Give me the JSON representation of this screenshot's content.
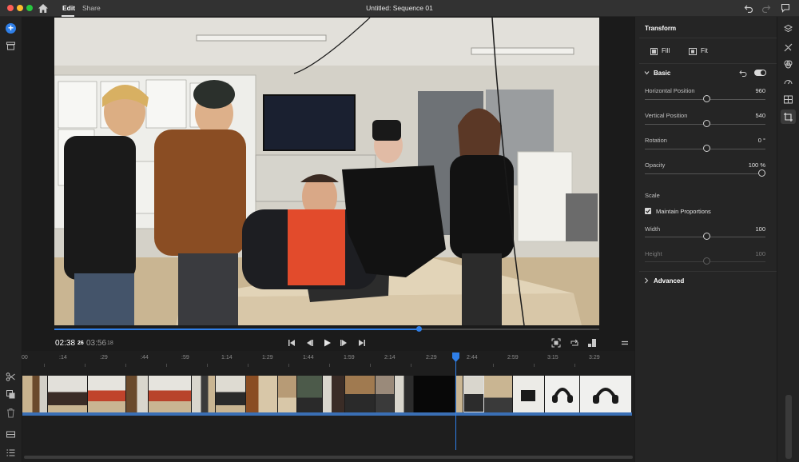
{
  "window": {
    "menu": [
      "Edit",
      "Share"
    ],
    "title": "Untitled: Sequence 01"
  },
  "playback": {
    "current_time": "02:38",
    "current_frames": "26",
    "total_time": "03:56",
    "total_frames": "18",
    "progress": 0.67
  },
  "ruler": {
    "labels": [
      "00",
      ":14",
      ":29",
      ":44",
      ":59",
      "1:14",
      "1:29",
      "1:44",
      "1:59",
      "2:14",
      "2:29",
      "2:44",
      "2:59",
      "3:15",
      "3:29"
    ]
  },
  "panel": {
    "title": "Transform",
    "fill_label": "Fill",
    "fit_label": "Fit",
    "basic_label": "Basic",
    "horizontal_label": "Horizontal Position",
    "horizontal_value": "960",
    "vertical_label": "Vertical Position",
    "vertical_value": "540",
    "rotation_label": "Rotation",
    "rotation_value": "0 °",
    "opacity_label": "Opacity",
    "opacity_value": "100 %",
    "scale_label": "Scale",
    "maintain_label": "Maintain Proportions",
    "width_label": "Width",
    "width_value": "100",
    "height_label": "Height",
    "height_value": "100",
    "advanced_label": "Advanced"
  },
  "colors": {
    "accent": "#2f7fe8",
    "panel_bg": "#252525",
    "app_bg": "#1e1e1e"
  },
  "icons": {
    "left_toolbar": [
      "add-media-icon",
      "media-bin-icon",
      "scissors-icon",
      "duplicate-icon",
      "trash-icon",
      "track-icon",
      "list-icon"
    ],
    "right_rail": [
      "titles-icon",
      "transitions-icon",
      "color-icon",
      "speed-icon",
      "audio-icon",
      "crop-icon"
    ]
  }
}
